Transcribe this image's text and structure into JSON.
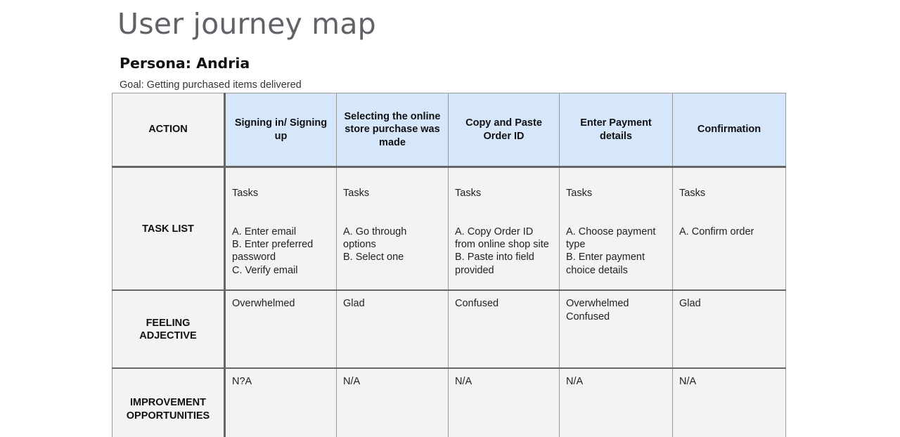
{
  "slide": {
    "title": "User journey map",
    "persona": "Persona: Andria",
    "goal": "Goal: Getting purchased items delivered"
  },
  "table": {
    "row_labels": {
      "action": "ACTION",
      "task_list": "TASK LIST",
      "feeling": "FEELING\nADJECTIVE",
      "improvement": "IMPROVEMENT\nOPPORTUNITIES"
    },
    "columns": [
      {
        "action": "Signing in/ Signing up",
        "tasks_label": "Tasks",
        "tasks": "A. Enter email\nB. Enter preferred password\nC. Verify email",
        "feeling": "Overwhelmed",
        "improvement": "N?A"
      },
      {
        "action": "Selecting the online store purchase was made",
        "tasks_label": "Tasks",
        "tasks": "A. Go through options\nB. Select one",
        "feeling": "Glad",
        "improvement": "N/A"
      },
      {
        "action": "Copy and Paste Order ID",
        "tasks_label": "Tasks",
        "tasks": "A. Copy Order ID from online shop site\nB. Paste into field provided",
        "feeling": "Confused",
        "improvement": "N/A"
      },
      {
        "action": "Enter Payment details",
        "tasks_label": "Tasks",
        "tasks": "A. Choose payment type\nB. Enter payment choice details",
        "feeling": "Overwhelmed\nConfused",
        "improvement": "N/A"
      },
      {
        "action": "Confirmation",
        "tasks_label": "Tasks",
        "tasks": "A. Confirm order",
        "feeling": "Glad",
        "improvement": "N/A"
      }
    ]
  }
}
